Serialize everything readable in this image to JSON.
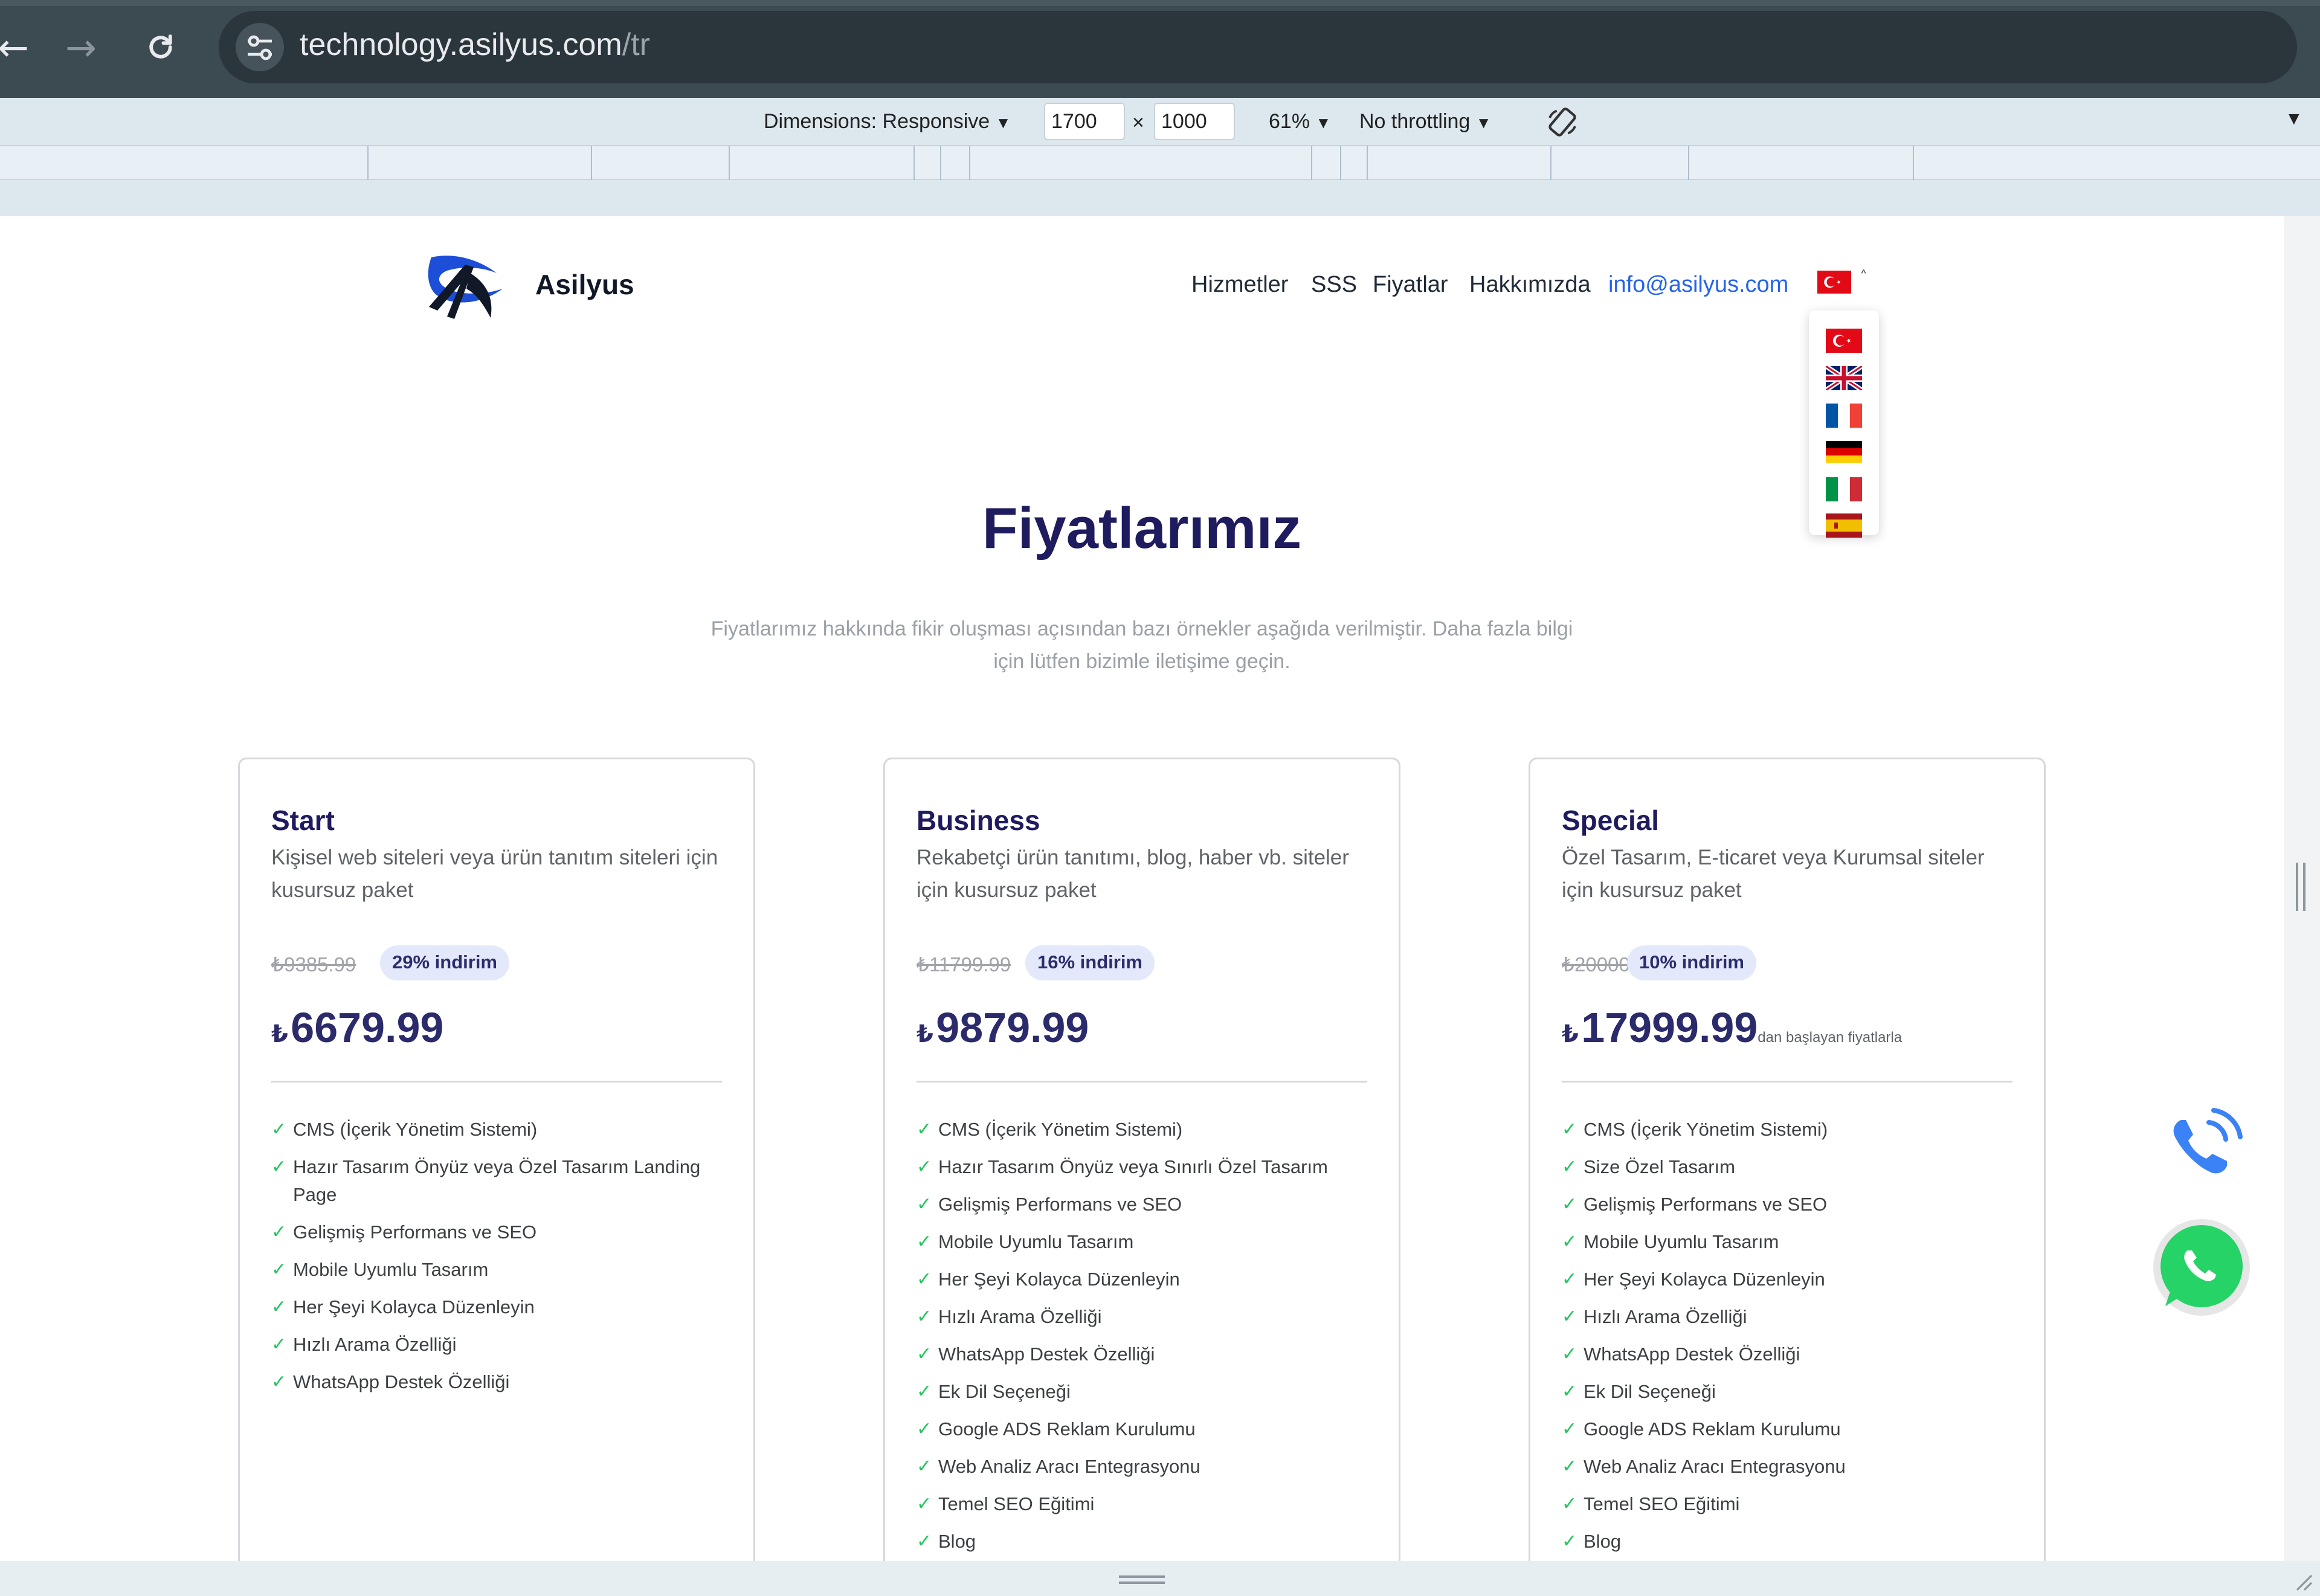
{
  "browser": {
    "url_host": "technology.asilyus.com",
    "url_path": "/tr",
    "back_icon": "back-arrow-icon",
    "forward_icon": "forward-arrow-icon",
    "reload_icon": "reload-icon",
    "site_settings_icon": "tune-icon"
  },
  "devtools": {
    "dimensions_label": "Dimensions: Responsive",
    "width": "1700",
    "x_sep": "×",
    "height": "1000",
    "zoom": "61%",
    "throttling": "No throttling",
    "caret": "▼",
    "rotate_icon": "rotate-icon",
    "more_icon": "chevron-down-icon"
  },
  "site": {
    "brand": "Asilyus",
    "menu": [
      "Hizmetler",
      "SSS",
      "Fiyatlar",
      "Hakkımızda"
    ],
    "email": "info@asilyus.com",
    "languages": [
      "tr",
      "en",
      "fr",
      "de",
      "it",
      "es"
    ],
    "caret": "˄"
  },
  "heading": {
    "title": "Fiyatlarımız",
    "subtitle": "Fiyatlarımız hakkında fikir oluşması açısından bazı örnekler aşağıda verilmiştir. Daha fazla bilgi için lütfen bizimle iletişime geçin."
  },
  "plans": [
    {
      "name": "Start",
      "description": "Kişisel web siteleri veya ürün tanıtım siteleri için kusursuz paket",
      "old_price": "₺9385.99",
      "discount": "29% indirim",
      "currency": "₺",
      "price": "6679.99",
      "note": "",
      "features": [
        "CMS (İçerik Yönetim Sistemi)",
        "Hazır Tasarım Önyüz veya Özel Tasarım Landing Page",
        "Gelişmiş Performans ve SEO",
        "Mobile Uyumlu Tasarım",
        "Her Şeyi Kolayca Düzenleyin",
        "Hızlı Arama Özelliği",
        "WhatsApp Destek Özelliği"
      ]
    },
    {
      "name": "Business",
      "description": "Rekabetçi ürün tanıtımı, blog, haber vb. siteler için kusursuz paket",
      "old_price": "₺11799.99",
      "discount": "16% indirim",
      "currency": "₺",
      "price": "9879.99",
      "note": "",
      "features": [
        "CMS (İçerik Yönetim Sistemi)",
        "Hazır Tasarım Önyüz veya Sınırlı Özel Tasarım",
        "Gelişmiş Performans ve SEO",
        "Mobile Uyumlu Tasarım",
        "Her Şeyi Kolayca Düzenleyin",
        "Hızlı Arama Özelliği",
        "WhatsApp Destek Özelliği",
        "Ek Dil Seçeneği",
        "Google ADS Reklam Kurulumu",
        "Web Analiz Aracı Entegrasyonu",
        "Temel SEO Eğitimi",
        "Blog"
      ]
    },
    {
      "name": "Special",
      "description": "Özel Tasarım, E-ticaret veya Kurumsal siteler için kusursuz paket",
      "old_price": "₺20000",
      "discount": "10% indirim",
      "currency": "₺",
      "price": "17999.99",
      "note": "dan başlayan fiyatlarla",
      "features": [
        "CMS (İçerik Yönetim Sistemi)",
        "Size Özel Tasarım",
        "Gelişmiş Performans ve SEO",
        "Mobile Uyumlu Tasarım",
        "Her Şeyi Kolayca Düzenleyin",
        "Hızlı Arama Özelliği",
        "WhatsApp Destek Özelliği",
        "Ek Dil Seçeneği",
        "Google ADS Reklam Kurulumu",
        "Web Analiz Aracı Entegrasyonu",
        "Temel SEO Eğitimi",
        "Blog"
      ]
    }
  ],
  "check_glyph": "✓",
  "colors": {
    "heading": "#1e1b5e",
    "link": "#2563eb",
    "check": "#22c55e",
    "badge_bg": "#e3e8fb",
    "whatsapp": "#25d366",
    "phone": "#3b82f6"
  },
  "floating": {
    "phone_icon": "phone-call-icon",
    "whatsapp_icon": "whatsapp-icon"
  }
}
